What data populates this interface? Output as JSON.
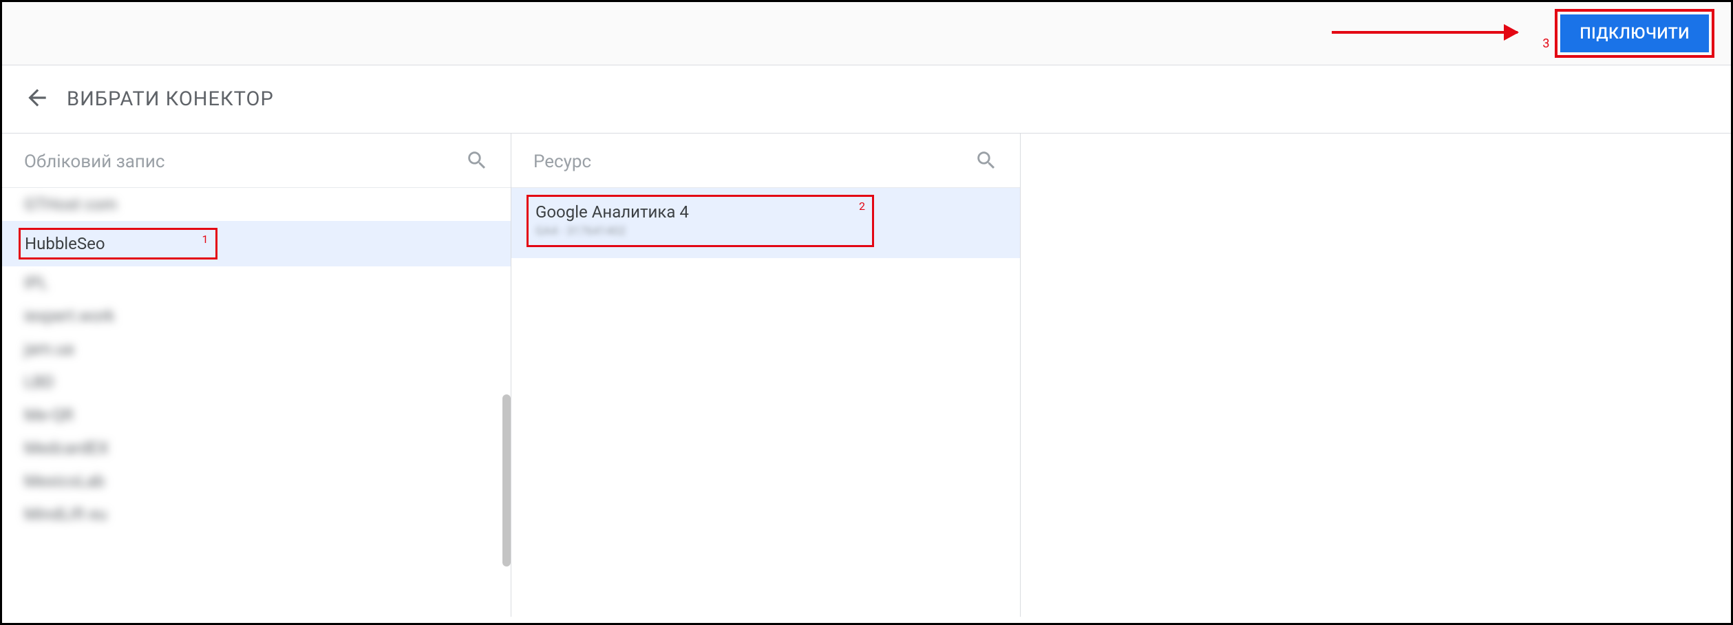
{
  "header": {
    "connect_label": "ПІДКЛЮЧИТИ",
    "page_title": "ВИБРАТИ КОНЕКТОР"
  },
  "columns": {
    "account": {
      "title": "Обліковий запис",
      "items": [
        {
          "label": "GTHost com",
          "blurred": true
        },
        {
          "label": "HubbleSeo",
          "blurred": false,
          "selected": true,
          "annotation": "1"
        },
        {
          "label": "IPL",
          "blurred": true
        },
        {
          "label": "iexpert.work",
          "blurred": true
        },
        {
          "label": "jam.ua",
          "blurred": true
        },
        {
          "label": "LBD",
          "blurred": true
        },
        {
          "label": "Me-QR",
          "blurred": true
        },
        {
          "label": "MedcardEX",
          "blurred": true
        },
        {
          "label": "MexicoLab",
          "blurred": true
        },
        {
          "label": "MindLift eu",
          "blurred": true
        }
      ]
    },
    "resource": {
      "title": "Ресурс",
      "items": [
        {
          "title": "Google Аналитика 4",
          "subtitle": "GA4 - 317641402",
          "selected": true,
          "annotation": "2"
        }
      ]
    }
  },
  "annotations": {
    "button": "3"
  }
}
